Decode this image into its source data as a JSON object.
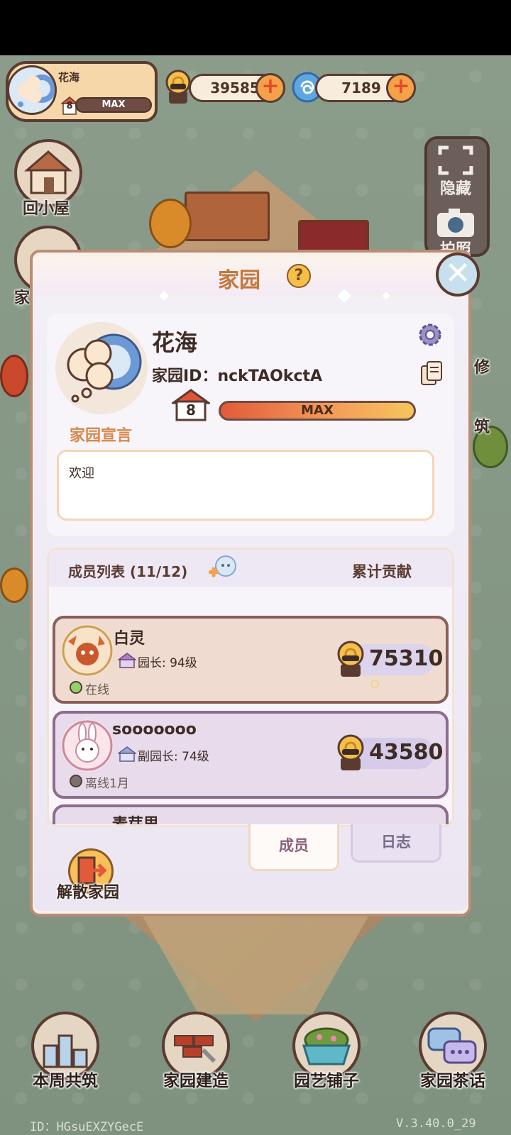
{
  "hud": {
    "profile_name": "花海",
    "profile_level": "8",
    "profile_level_bar": "MAX",
    "snail_coins": "39585",
    "spirals": "7189",
    "plus_symbol": "+"
  },
  "side_left": {
    "home_label": "回小屋",
    "garden_label_partial": "家"
  },
  "side_right": {
    "hide_label": "隐藏",
    "photo_label": "拍照",
    "decor_partial": "修",
    "build_partial": "筑"
  },
  "dialog": {
    "title": "家园",
    "help_symbol": "?",
    "close_symbol": "✕",
    "garden_name": "花海",
    "garden_id_label": "家园ID：",
    "garden_id_value": "nckTAOkctA",
    "level": "8",
    "level_bar": "MAX",
    "declaration_label": "家园宣言",
    "declaration_text": "欢迎",
    "members_title": "成员列表 (11/12)",
    "contribution_title": "累计贡献",
    "members": [
      {
        "name": "白灵",
        "role": "园长: 94级",
        "status": "在线",
        "status_color": "#8fd46a",
        "contribution": "75310"
      },
      {
        "name": "sooooooo",
        "role": "副园长: 74级",
        "status": "离线1月",
        "status_color": "#7a7270",
        "contribution": "43580"
      },
      {
        "name": "麦芽思",
        "role": "",
        "status": "",
        "contribution": ""
      }
    ],
    "tabs": {
      "members": "成员",
      "log": "日志"
    },
    "disband_label": "解散家园"
  },
  "bottom_nav": [
    {
      "label": "本周共筑",
      "icon": "podium-icon"
    },
    {
      "label": "家园建造",
      "icon": "bricks-icon"
    },
    {
      "label": "园艺铺子",
      "icon": "flower-basket-icon"
    },
    {
      "label": "家园茶话",
      "icon": "chat-bubbles-icon"
    }
  ],
  "footer": {
    "id_text": "ID：HGsuEXZYGecE",
    "version_text": "V.3.40.0_29"
  },
  "colors": {
    "accent_orange": "#c5773d",
    "brown_border": "#5b3b30",
    "online": "#8fd46a",
    "offline": "#7a7270"
  }
}
